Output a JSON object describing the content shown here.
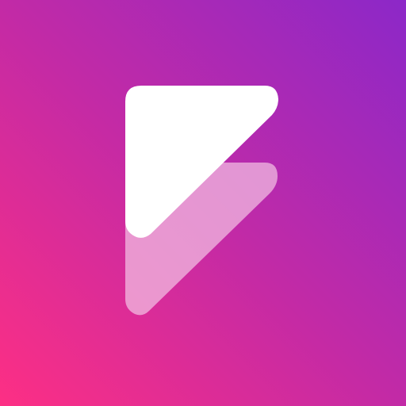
{
  "icon": {
    "name": "app-logo-icon",
    "colors": {
      "gradient_start": "#fd2f84",
      "gradient_mid": "#c22aa6",
      "gradient_end": "#8c28c8",
      "front_shape": "#ffffff",
      "back_shape": "#f2c0e3"
    },
    "back_shape_opacity": 0.72
  }
}
